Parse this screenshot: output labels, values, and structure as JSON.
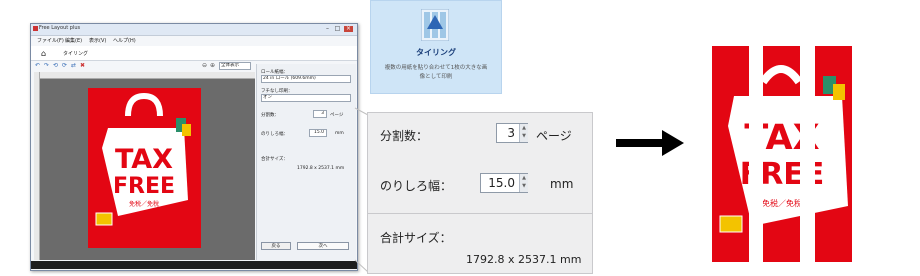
{
  "window": {
    "title": "Free Layout plus",
    "menus": [
      "ファイル(F)",
      "編集(E)",
      "表示(V)",
      "ヘルプ(H)"
    ],
    "tab": "タイリング",
    "zoom_select": "全体表示"
  },
  "poster": {
    "line1": "TAX",
    "line2": "FREE",
    "subtitle": "免税／免稅"
  },
  "panel": {
    "roll_width_label": "ロール紙幅：",
    "roll_width_value": "24 in ロール (609.6mm)",
    "borderless_label": "フチなし印刷：",
    "borderless_value": "オン",
    "divisions_label": "分割数：",
    "divisions_value": "3",
    "divisions_unit": "ページ",
    "margin_label": "のりしろ幅：",
    "margin_value": "15.0",
    "margin_unit": "mm",
    "total_label": "合計サイズ：",
    "total_value": "1792.8 x 2537.1 mm",
    "back_button": "戻る",
    "next_button": "次へ"
  },
  "tiling": {
    "title": "タイリング",
    "description_line1": "複数の用紙を貼り合わせて1枚の大きな画",
    "description_line2": "像として印刷"
  },
  "zoom": {
    "divisions_label": "分割数：",
    "divisions_value": "3",
    "divisions_unit": "ページ",
    "margin_label": "のりしろ幅：",
    "margin_value": "15.0",
    "margin_unit": "mm",
    "total_label": "合計サイズ：",
    "total_value": "1792.8 x 2537.1 mm"
  },
  "colors": {
    "poster_red": "#e30613",
    "arrow": "#000000"
  }
}
